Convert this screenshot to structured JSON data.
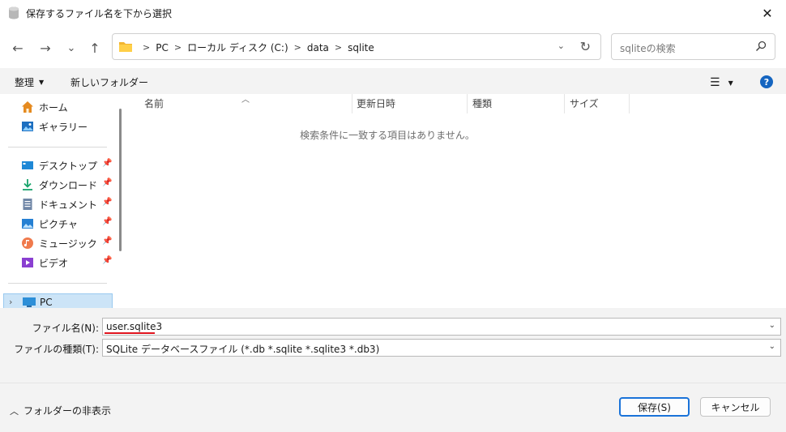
{
  "window": {
    "title": "保存するファイル名を下から選択",
    "close_glyph": "✕"
  },
  "nav": {
    "back": "←",
    "forward": "→",
    "recent": "⌄",
    "up": "↑"
  },
  "address": {
    "crumbs": [
      "PC",
      "ローカル ディスク (C:)",
      "data",
      "sqlite"
    ],
    "dropdown": "⌄",
    "refresh": "↻"
  },
  "search": {
    "placeholder": "sqliteの検索"
  },
  "toolbar": {
    "organize": "整理",
    "organize_arrow": "▼",
    "new_folder": "新しいフォルダー",
    "view_icon": "☰",
    "view_arrow": "▼",
    "help": "?"
  },
  "sidebar": {
    "items": [
      {
        "label": "ホーム",
        "icon": "home-icon",
        "pinned": false
      },
      {
        "label": "ギャラリー",
        "icon": "gallery-icon",
        "pinned": false
      },
      {
        "label": "デスクトップ",
        "icon": "desktop-icon",
        "pinned": true
      },
      {
        "label": "ダウンロード",
        "icon": "download-icon",
        "pinned": true
      },
      {
        "label": "ドキュメント",
        "icon": "document-icon",
        "pinned": true
      },
      {
        "label": "ピクチャ",
        "icon": "picture-icon",
        "pinned": true
      },
      {
        "label": "ミュージック",
        "icon": "music-icon",
        "pinned": true
      },
      {
        "label": "ビデオ",
        "icon": "video-icon",
        "pinned": true
      }
    ],
    "pin_glyph": "📌",
    "pc": {
      "label": "PC",
      "chevron": "›"
    }
  },
  "filelist": {
    "columns": [
      "名前",
      "更新日時",
      "種類",
      "サイズ"
    ],
    "sort_arrow": "︿",
    "empty_message": "検索条件に一致する項目はありません。"
  },
  "form": {
    "filename_label": "ファイル名(N):",
    "filename_value": "user.sqlite3",
    "filetype_label": "ファイルの種類(T):",
    "filetype_value": "SQLite データベースファイル (*.db *.sqlite *.sqlite3 *.db3)",
    "dropdown_glyph": "⌄"
  },
  "footer": {
    "toggle_label": "フォルダーの非表示",
    "toggle_glyph": "︿",
    "save": "保存(S)",
    "cancel": "キャンセル"
  },
  "colors": {
    "accent": "#1a73d9",
    "selection": "#cce4f7",
    "underline": "#e0141e",
    "help": "#1565c0"
  }
}
